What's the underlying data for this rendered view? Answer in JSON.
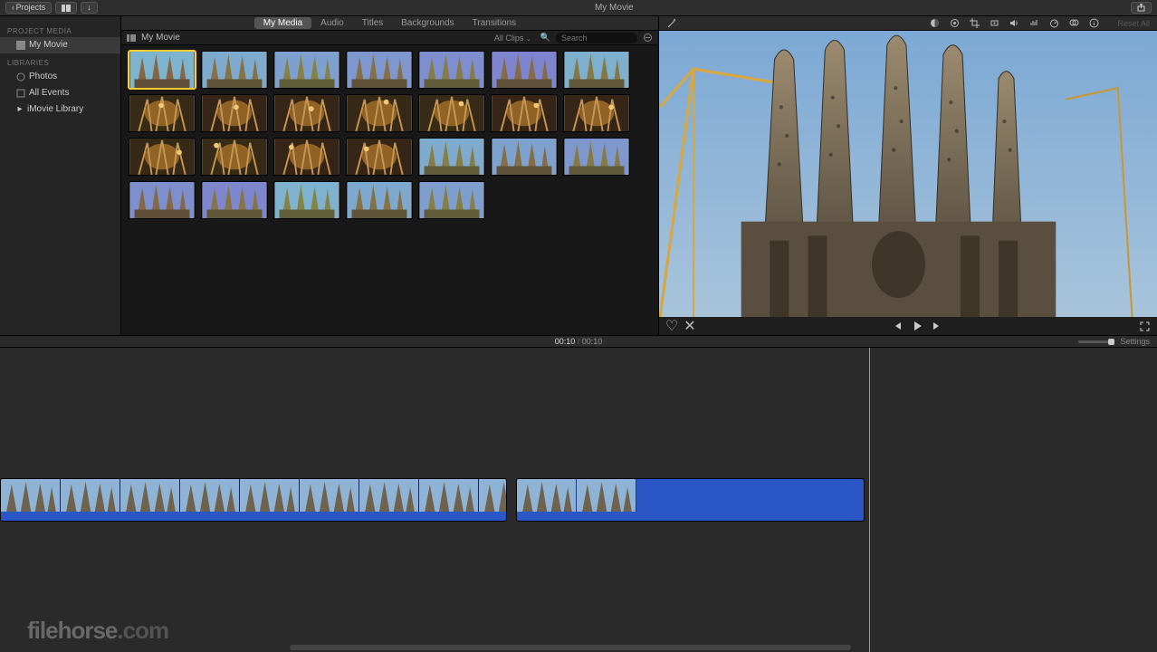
{
  "titlebar": {
    "back_label": "Projects",
    "title": "My Movie"
  },
  "sidebar": {
    "section1": "PROJECT MEDIA",
    "project_item": "My Movie",
    "section2": "LIBRARIES",
    "items": [
      {
        "label": "Photos"
      },
      {
        "label": "All Events"
      },
      {
        "label": "iMovie Library"
      }
    ]
  },
  "tabs": {
    "items": [
      "My Media",
      "Audio",
      "Titles",
      "Backgrounds",
      "Transitions"
    ],
    "active": 0
  },
  "browser": {
    "crumb": "My Movie",
    "filter": "All Clips",
    "search_placeholder": "Search",
    "clip_count": 26
  },
  "viewer": {
    "reset_label": "Reset All"
  },
  "timecode": {
    "current": "00:10",
    "total": "00:10",
    "settings_label": "Settings"
  },
  "timeline": {
    "clip1_frames": 9,
    "clip2_frames": 2
  },
  "watermark": "filehorse",
  "watermark_tld": ".com"
}
